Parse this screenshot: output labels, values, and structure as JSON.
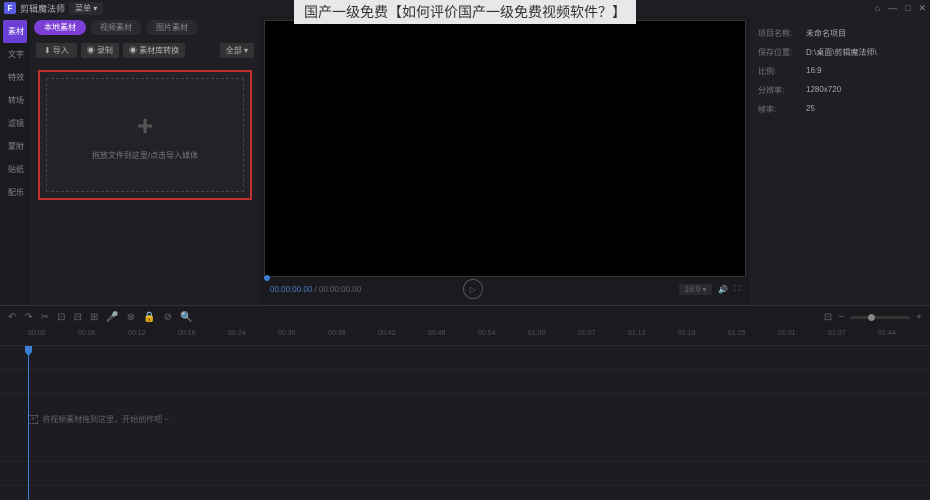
{
  "app": {
    "name": "剪辑魔法师",
    "menu": "菜单"
  },
  "overlay": "国产一级免费【如何评价国产一级免费视频软件？】",
  "window": {
    "home": "⌂",
    "min": "—",
    "max": "□",
    "close": "✕"
  },
  "sidebar": {
    "items": [
      {
        "label": "素材"
      },
      {
        "label": "文字"
      },
      {
        "label": "特效"
      },
      {
        "label": "转场"
      },
      {
        "label": "滤镜"
      },
      {
        "label": "蒙附"
      },
      {
        "label": "贴纸"
      },
      {
        "label": "配乐"
      }
    ]
  },
  "media": {
    "tabs": [
      {
        "label": "本地素材"
      },
      {
        "label": "视频素材"
      },
      {
        "label": "图片素材"
      }
    ],
    "import": "导入",
    "filter1": "录制",
    "filter2": "素材库转换",
    "filterAll": "全部",
    "dropText": "拖放文件到这里/点击导入媒体"
  },
  "preview": {
    "cur": "00:00:00.00",
    "dur": "00:00:00.00",
    "play": "▷",
    "ratio": "16:9",
    "vol": "🔊",
    "full": "⛶"
  },
  "props": {
    "rows": [
      {
        "label": "项目名称:",
        "value": "未命名项目"
      },
      {
        "label": "保存位置:",
        "value": "D:\\桌面\\剪辑魔法师\\"
      },
      {
        "label": "比例:",
        "value": "16:9"
      },
      {
        "label": "分辨率:",
        "value": "1280x720"
      },
      {
        "label": "帧率:",
        "value": "25"
      }
    ]
  },
  "timeline": {
    "tools": [
      "↶",
      "↷",
      "✂",
      "⊡",
      "⊟",
      "⊞",
      "🎤",
      "⊗",
      "🔒",
      "⊘",
      "🔍"
    ],
    "ticks": [
      "00:00",
      "00:06",
      "00:12",
      "00:18",
      "00:24",
      "00:30",
      "00:36",
      "00:42",
      "00:48",
      "00:54",
      "01:00",
      "01:07",
      "01:13",
      "01:19",
      "01:25",
      "01:31",
      "01:37",
      "01:44"
    ],
    "hint": "将视频素材拖到这里，开始创作吧 ~",
    "hintIcon": "+"
  }
}
